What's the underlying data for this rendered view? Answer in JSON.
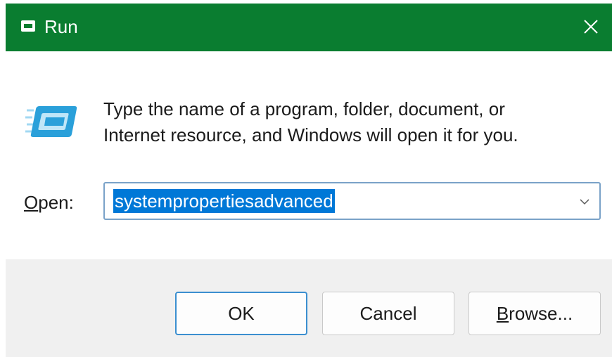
{
  "window": {
    "title": "Run",
    "title_icon": "run-icon",
    "close_icon": "close-icon",
    "accent_color": "#0a7d30"
  },
  "body": {
    "icon": "run-program-icon",
    "description_line1": "Type the name of a program, folder, document, or",
    "description_line2": "Internet resource, and Windows will open it for you.",
    "open_label_mnemonic": "O",
    "open_label_rest": "pen:",
    "open_value": "systempropertiesadvanced",
    "dropdown_icon": "chevron-down-icon"
  },
  "footer": {
    "ok_label": "OK",
    "cancel_label": "Cancel",
    "browse_mnemonic": "B",
    "browse_rest": "rowse..."
  }
}
